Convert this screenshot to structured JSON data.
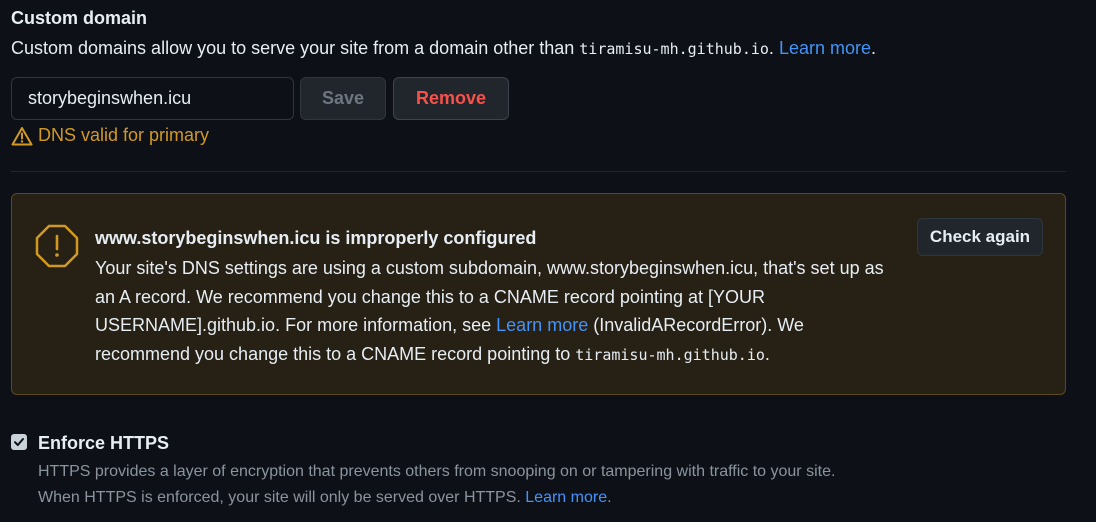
{
  "custom_domain": {
    "title": "Custom domain",
    "description_prefix": "Custom domains allow you to serve your site from a domain other than ",
    "default_domain": "tiramisu-mh.github.io",
    "description_suffix": ". ",
    "learn_more": "Learn more",
    "description_end": ".",
    "input_value": "storybeginswhen.icu",
    "save_label": "Save",
    "remove_label": "Remove",
    "dns_status": "DNS valid for primary"
  },
  "warning": {
    "title": "www.storybeginswhen.icu is improperly configured",
    "body_part1": "Your site's DNS settings are using a custom subdomain, www.storybeginswhen.icu, that's set up as an A record. We recommend you change this to a CNAME record pointing at [YOUR USERNAME].github.io. For more information, see ",
    "learn_more": "Learn more",
    "body_part2": " (InvalidARecordError). We recommend you change this to a CNAME record pointing to ",
    "target_domain": "tiramisu-mh.github.io",
    "body_end": ".",
    "check_again_label": "Check again"
  },
  "enforce_https": {
    "checked": true,
    "title": "Enforce HTTPS",
    "description_line1": "HTTPS provides a layer of encryption that prevents others from snooping on or tampering with traffic to your site.",
    "description_line2": "When HTTPS is enforced, your site will only be served over HTTPS. ",
    "learn_more": "Learn more",
    "description_end": "."
  },
  "colors": {
    "background": "#0d1117",
    "link": "#4493f8",
    "warning": "#d29922",
    "danger": "#f85149",
    "muted_text": "#8b949e"
  },
  "icons": {
    "dns_status": "alert-triangle-icon",
    "warning": "alert-octagon-icon",
    "checkbox": "check-icon"
  }
}
